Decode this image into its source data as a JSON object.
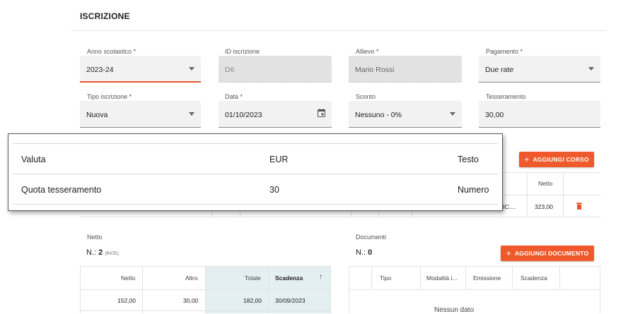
{
  "section_title": "ISCRIZIONE",
  "fields": {
    "anno": {
      "label": "Anno scolastico *",
      "value": "2023-24"
    },
    "id": {
      "label": "ID iscrizione",
      "value": "D6"
    },
    "allievo": {
      "label": "Allievo *",
      "value": "Mario Rossi"
    },
    "pagamento": {
      "label": "Pagamento *",
      "value": "Due rate"
    },
    "tipo": {
      "label": "Tipo iscrizione *",
      "value": "Nuova"
    },
    "data": {
      "label": "Data *",
      "value": "01/10/2023"
    },
    "sconto": {
      "label": "Sconto",
      "value": "Nessuno - 0%"
    },
    "tesseramento": {
      "label": "Tesseramento",
      "value": "30,00"
    }
  },
  "corsi": {
    "add_button": "AGGIUNGI CORSO",
    "header_netto": "Netto",
    "row": {
      "partial": "IC:...",
      "netto": "323,00"
    }
  },
  "popup": {
    "rows": [
      {
        "name": "Valuta",
        "value": "EUR",
        "type": "Testo"
      },
      {
        "name": "Quota tesseramento",
        "value": "30",
        "type": "Numero"
      }
    ]
  },
  "rate": {
    "label": "Netto",
    "count_prefix": "N.:",
    "count": "2",
    "count_suffix": "(RATE)",
    "columns": [
      "Netto",
      "Altro",
      "Totale",
      "Scadenza"
    ],
    "sort_icon": "↑",
    "rows": [
      {
        "netto": "152,00",
        "altro": "30,00",
        "totale": "182,00",
        "scadenza": "30/09/2023"
      }
    ]
  },
  "documenti": {
    "label": "Documenti",
    "count_prefix": "N.:",
    "count": "0",
    "add_button": "AGGIUNGI DOCUMENTO",
    "columns": [
      "Tipo",
      "Modalità i...",
      "Emissione",
      "Scadenza"
    ],
    "empty": "Nessun dato"
  },
  "colors": {
    "accent": "#ee5a2b",
    "field_bg": "#f2f2f2",
    "highlight_col": "#e3eff0"
  }
}
